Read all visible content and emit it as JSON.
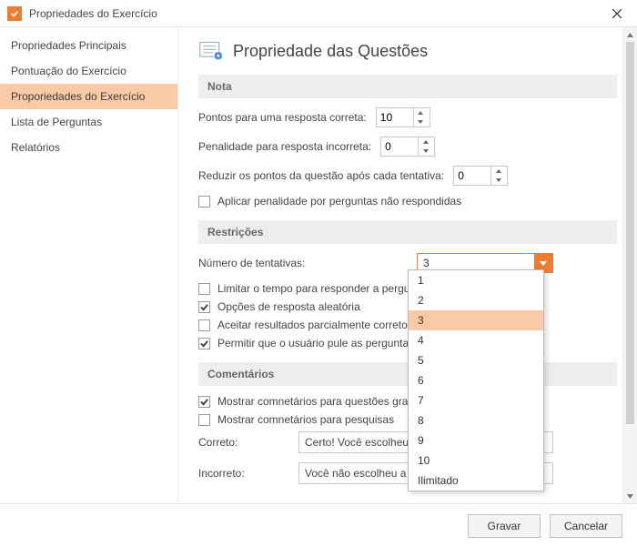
{
  "window": {
    "title": "Propriedades do Exercício"
  },
  "sidebar": {
    "items": [
      {
        "label": "Propriedades Principais"
      },
      {
        "label": "Pontuação do Exercício"
      },
      {
        "label": "Proporiedades do Exercício"
      },
      {
        "label": "Lista de Perguntas"
      },
      {
        "label": "Relatórios"
      }
    ],
    "active_index": 2
  },
  "header": {
    "title": "Propriedade das Questões"
  },
  "nota": {
    "heading": "Nota",
    "points_correct_label": "Pontos para uma resposta correta:",
    "points_correct_value": "10",
    "penalty_incorrect_label": "Penalidade para resposta incorreta:",
    "penalty_incorrect_value": "0",
    "reduce_after_attempt_label": "Reduzir os pontos da questão após cada tentativa:",
    "reduce_after_attempt_value": "0",
    "apply_penalty_unanswered_label": "Aplicar penalidade por perguntas não respondidas",
    "apply_penalty_unanswered_checked": false
  },
  "restricoes": {
    "heading": "Restrições",
    "attempts_label": "Número de tentativas:",
    "attempts_selected": "3",
    "attempts_options": [
      "1",
      "2",
      "3",
      "4",
      "5",
      "6",
      "7",
      "8",
      "9",
      "10",
      "Ilimitado"
    ],
    "limit_time_label": "Limitar o tempo para responder a pergunta:",
    "limit_time_checked": false,
    "random_options_label": "Opções de resposta aleatória",
    "random_options_checked": true,
    "accept_partial_label": "Aceitar resultados parcialmente corretos",
    "accept_partial_checked": false,
    "allow_skip_label": "Permitir que o usuário pule as perguntas da p",
    "allow_skip_checked": true
  },
  "comentarios": {
    "heading": "Comentários",
    "show_graded_label": "Mostrar comnetários para questões graduada",
    "show_graded_checked": true,
    "show_surveys_label": "Mostrar comnetários para pesquisas",
    "show_surveys_checked": false,
    "correct_label": "Correto:",
    "correct_value": "Certo! Você escolheu a re",
    "incorrect_label": "Incorreto:",
    "incorrect_value": "Você não escolheu a resp"
  },
  "footer": {
    "save": "Gravar",
    "cancel": "Cancelar"
  }
}
